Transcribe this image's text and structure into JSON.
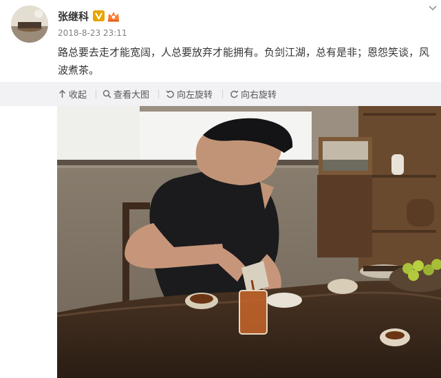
{
  "post": {
    "username": "张继科",
    "timestamp": "2018-8-23 23:11",
    "text": "路总要去走才能宽阔，人总要放弃才能拥有。负剑江湖，总有是非；恩怨笑谈，风波煮茶。",
    "icons": {
      "verified": "verified-v-badge",
      "member": "crown-member-badge",
      "menu": "chevron-down-icon"
    },
    "colors": {
      "verified": "#e8a400",
      "member": "#ff7a2f",
      "toolbar_bg": "#f2f2f5"
    }
  },
  "toolbar": {
    "collapse_label": "收起",
    "view_large_label": "查看大图",
    "rotate_left_label": "向左旋转",
    "rotate_right_label": "向右旋转"
  },
  "photo": {
    "subject": "man pouring tea at a wooden tea table"
  }
}
